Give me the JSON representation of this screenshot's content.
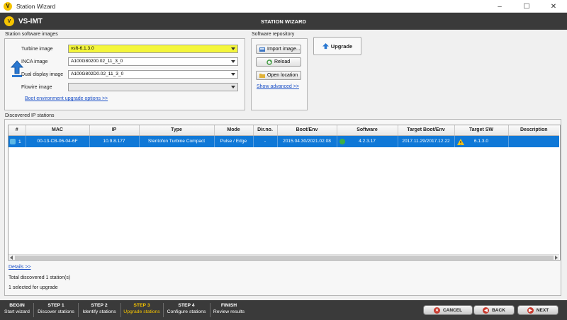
{
  "window": {
    "title": "Station Wizard",
    "minimize": "–",
    "maximize": "☐",
    "close": "✕"
  },
  "header": {
    "brand": "VS-IMT",
    "title": "STATION WIZARD"
  },
  "images": {
    "group_label": "Station software images",
    "turbine_label": "Turbine image",
    "turbine_value": "vsft-6.1.3.0",
    "inca_label": "INCA image",
    "inca_value": "A100G80200.02_11_3_0",
    "dual_label": "Dual display image",
    "dual_value": "A100G802D0.02_11_3_0",
    "flowire_label": "Flowire image",
    "flowire_value": "",
    "boot_link": "Boot environment upgrade options >>"
  },
  "repo": {
    "group_label": "Software repository",
    "import": "Import image...",
    "reload": "Reload",
    "open": "Open location",
    "advanced_link": "Show advanced >>"
  },
  "upgrade_label": "Upgrade",
  "discovered": {
    "group_label": "Discovered IP stations",
    "columns": [
      "#",
      "MAC",
      "IP",
      "Type",
      "Mode",
      "Dir.no.",
      "Boot/Env",
      "Software",
      "Target Boot/Env",
      "Target SW",
      "Description"
    ],
    "rows": [
      {
        "num": "1",
        "mac": "00-13-CB-06-04-6F",
        "ip": "10.9.8.177",
        "type": "Stentofon Turbine Compact",
        "mode": "Pulse / Edge",
        "dirno": "-",
        "boot": "2015.04.30/2021.02.08",
        "software": "4.2.3.17",
        "target_boot": "2017.11.29/2017.12.22",
        "target_sw": "6.1.3.0",
        "description": ""
      }
    ],
    "details_link": "Details >>",
    "total": "Total discovered 1 station(s)",
    "selected": "1 selected for upgrade"
  },
  "footer": {
    "steps": [
      {
        "t": "BEGIN",
        "s": "Start wizard"
      },
      {
        "t": "STEP 1",
        "s": "Discover stations"
      },
      {
        "t": "STEP 2",
        "s": "Identify stations"
      },
      {
        "t": "STEP 3",
        "s": "Upgrade stations"
      },
      {
        "t": "STEP 4",
        "s": "Configure stations"
      },
      {
        "t": "FINISH",
        "s": "Review results"
      }
    ],
    "cancel": "CANCEL",
    "back": "BACK",
    "next": "NEXT"
  },
  "colors": {
    "accent": "#f6c400",
    "selection": "#0f78d7",
    "highlight": "#f4f63a",
    "dark": "#3a3a3a"
  }
}
